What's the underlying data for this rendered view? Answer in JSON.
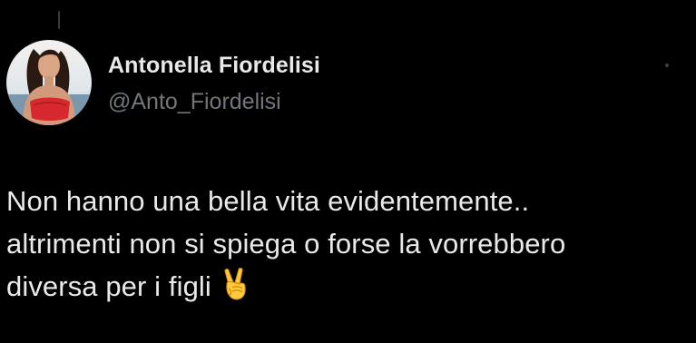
{
  "post": {
    "author": {
      "display_name": "Antonella Fiordelisi",
      "handle": "@Anto_Fiordelisi",
      "avatar": "profile-photo"
    },
    "text_lines": [
      "Non hanno una bella vita evidentemente..",
      "altrimenti non si spiega o forse la vorrebbero",
      "diversa per i figli"
    ],
    "emoji": "victory-hand-emoji"
  },
  "colors": {
    "background": "#000000",
    "primary_text": "#e7e9ea",
    "secondary_text": "#71767b"
  }
}
